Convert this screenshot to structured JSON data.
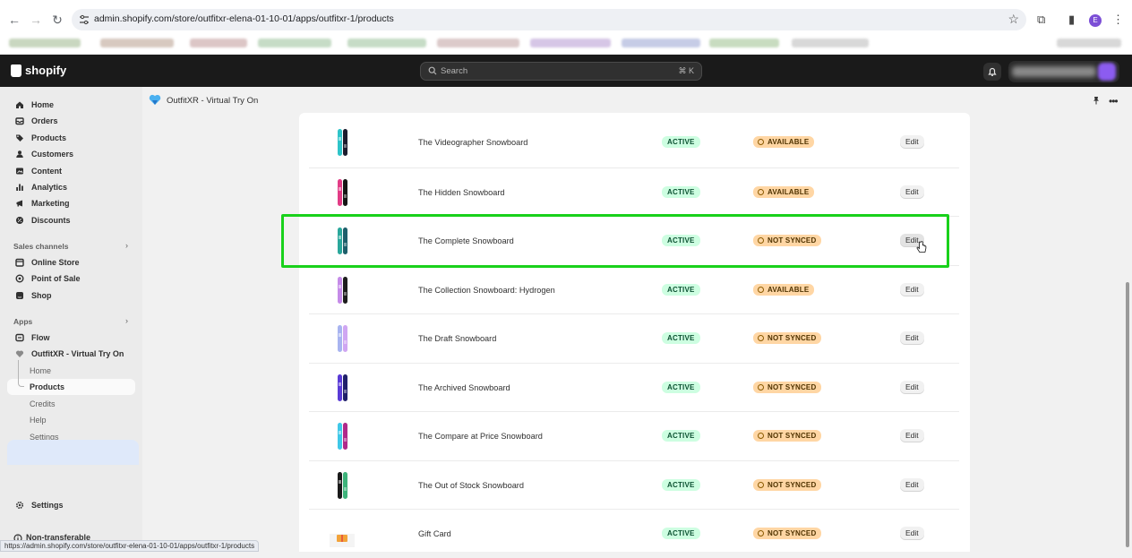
{
  "browser": {
    "url": "admin.shopify.com/store/outfitxr-elena-01-10-01/apps/outfitxr-1/products",
    "status_url": "https://admin.shopify.com/store/outfitxr-elena-01-10-01/apps/outfitxr-1/products",
    "profile_initial": "E"
  },
  "topbar": {
    "logo_text": "shopify",
    "search_placeholder": "Search",
    "search_shortcut": "⌘ K"
  },
  "sidebar": {
    "main": [
      {
        "label": "Home",
        "icon": "home-icon"
      },
      {
        "label": "Orders",
        "icon": "orders-icon"
      },
      {
        "label": "Products",
        "icon": "tag-icon"
      },
      {
        "label": "Customers",
        "icon": "person-icon"
      },
      {
        "label": "Content",
        "icon": "content-icon"
      },
      {
        "label": "Analytics",
        "icon": "bar-chart-icon"
      },
      {
        "label": "Marketing",
        "icon": "target-icon"
      },
      {
        "label": "Discounts",
        "icon": "discount-icon"
      }
    ],
    "sales_channels_label": "Sales channels",
    "sales_channels": [
      {
        "label": "Online Store",
        "icon": "store-icon"
      },
      {
        "label": "Point of Sale",
        "icon": "pos-icon"
      },
      {
        "label": "Shop",
        "icon": "shop-icon"
      }
    ],
    "apps_label": "Apps",
    "apps": [
      {
        "label": "Flow",
        "icon": "flow-icon"
      },
      {
        "label": "OutfitXR - Virtual Try On",
        "icon": "heart-icon"
      }
    ],
    "app_sub": [
      "Home",
      "Products",
      "Credits",
      "Help",
      "Settings"
    ],
    "settings_label": "Settings",
    "non_transferable_label": "Non-transferable"
  },
  "app": {
    "title": "OutfitXR - Virtual Try On"
  },
  "products": [
    {
      "name": "The Videographer Snowboard",
      "status": "ACTIVE",
      "sync": "AVAILABLE",
      "action": "Edit",
      "colors": [
        "#2ec4c9",
        "#1c1c2e"
      ]
    },
    {
      "name": "The Hidden Snowboard",
      "status": "ACTIVE",
      "sync": "AVAILABLE",
      "action": "Edit",
      "colors": [
        "#e23c86",
        "#161616"
      ]
    },
    {
      "name": "The Complete Snowboard",
      "status": "ACTIVE",
      "sync": "NOT SYNCED",
      "action": "Edit",
      "colors": [
        "#2aa79b",
        "#1d5f6b"
      ]
    },
    {
      "name": "The Collection Snowboard: Hydrogen",
      "status": "ACTIVE",
      "sync": "AVAILABLE",
      "action": "Edit",
      "colors": [
        "#c58be8",
        "#1d1d1d"
      ]
    },
    {
      "name": "The Draft Snowboard",
      "status": "ACTIVE",
      "sync": "NOT SYNCED",
      "action": "Edit",
      "colors": [
        "#a8b4f0",
        "#cfa6f2"
      ]
    },
    {
      "name": "The Archived Snowboard",
      "status": "ACTIVE",
      "sync": "NOT SYNCED",
      "action": "Edit",
      "colors": [
        "#5a3bd6",
        "#1f1f6a"
      ]
    },
    {
      "name": "The Compare at Price Snowboard",
      "status": "ACTIVE",
      "sync": "NOT SYNCED",
      "action": "Edit",
      "colors": [
        "#3fc8e8",
        "#b02a8a"
      ]
    },
    {
      "name": "The Out of Stock Snowboard",
      "status": "ACTIVE",
      "sync": "NOT SYNCED",
      "action": "Edit",
      "colors": [
        "#1a1a1a",
        "#3db37a"
      ]
    },
    {
      "name": "Gift Card",
      "status": "ACTIVE",
      "sync": "NOT SYNCED",
      "action": "Edit",
      "colors": [
        "#f2a33a",
        "#e85d3a"
      ]
    }
  ],
  "colors": {
    "highlight": "#19d11b",
    "active_badge": "#cdfee1",
    "sync_badge": "#ffd6a4"
  }
}
